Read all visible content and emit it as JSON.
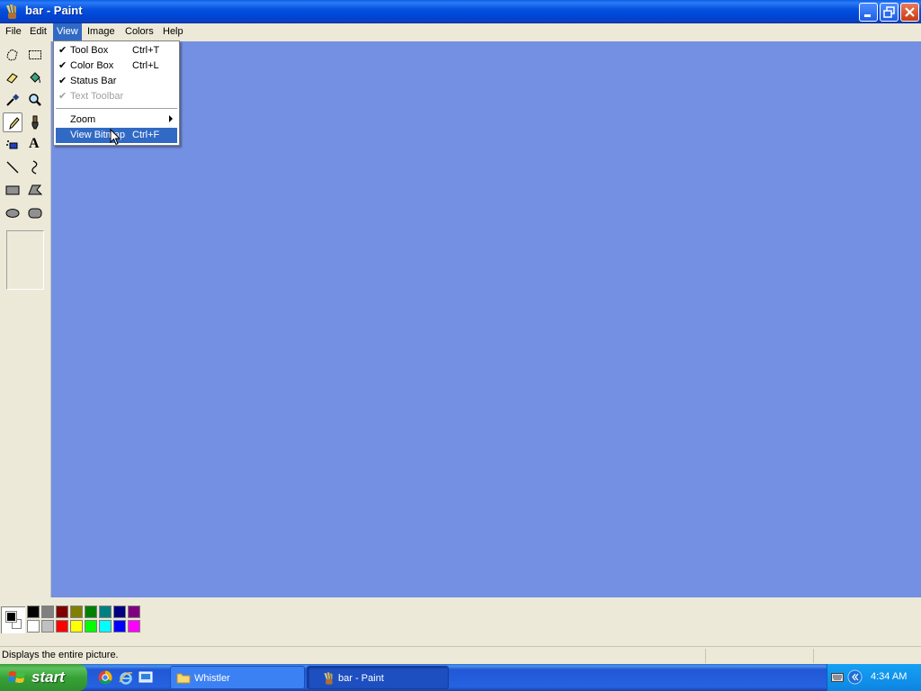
{
  "window": {
    "title": "bar - Paint"
  },
  "menubar": {
    "items": [
      "File",
      "Edit",
      "View",
      "Image",
      "Colors",
      "Help"
    ],
    "active": "View"
  },
  "view_menu": {
    "items": [
      {
        "label": "Tool Box",
        "shortcut": "Ctrl+T",
        "checked": true,
        "enabled": true
      },
      {
        "label": "Color Box",
        "shortcut": "Ctrl+L",
        "checked": true,
        "enabled": true
      },
      {
        "label": "Status Bar",
        "shortcut": "",
        "checked": true,
        "enabled": true
      },
      {
        "label": "Text Toolbar",
        "shortcut": "",
        "checked": true,
        "enabled": false
      },
      {
        "label": "Zoom",
        "shortcut": "",
        "submenu": true,
        "enabled": true
      },
      {
        "label": "View Bitmap",
        "shortcut": "Ctrl+F",
        "highlighted": true,
        "enabled": true
      }
    ],
    "check_glyph": "✔"
  },
  "toolbox": {
    "tools": [
      "free-form-select-icon",
      "select-icon",
      "eraser-icon",
      "fill-icon",
      "pick-color-icon",
      "magnifier-icon",
      "pencil-icon",
      "brush-icon",
      "airbrush-icon",
      "text-icon",
      "line-icon",
      "curve-icon",
      "rectangle-icon",
      "polygon-icon",
      "ellipse-icon",
      "rounded-rectangle-icon"
    ],
    "selected": "pencil-icon",
    "text_glyph": "A"
  },
  "canvas": {
    "background": "#7490e2"
  },
  "palette": {
    "foreground": "#000000",
    "background": "#ffffff",
    "top_row": [
      "#000000",
      "#808080",
      "#800000",
      "#808000",
      "#008000",
      "#008080",
      "#000080",
      "#800080"
    ],
    "bottom_row": [
      "#ffffff",
      "#c0c0c0",
      "#ff0000",
      "#ffff00",
      "#00ff00",
      "#00ffff",
      "#0000ff",
      "#ff00ff"
    ]
  },
  "statusbar": {
    "text": "Displays the entire picture."
  },
  "taskbar": {
    "start_label": "start",
    "quick_launch": [
      "chrome-icon",
      "internet-explorer-icon",
      "show-desktop-icon"
    ],
    "tasks": [
      {
        "label": "Whistler",
        "icon": "folder-icon"
      },
      {
        "label": "bar - Paint",
        "icon": "paint-icon",
        "active": true
      }
    ],
    "clock": "4:34 AM"
  }
}
